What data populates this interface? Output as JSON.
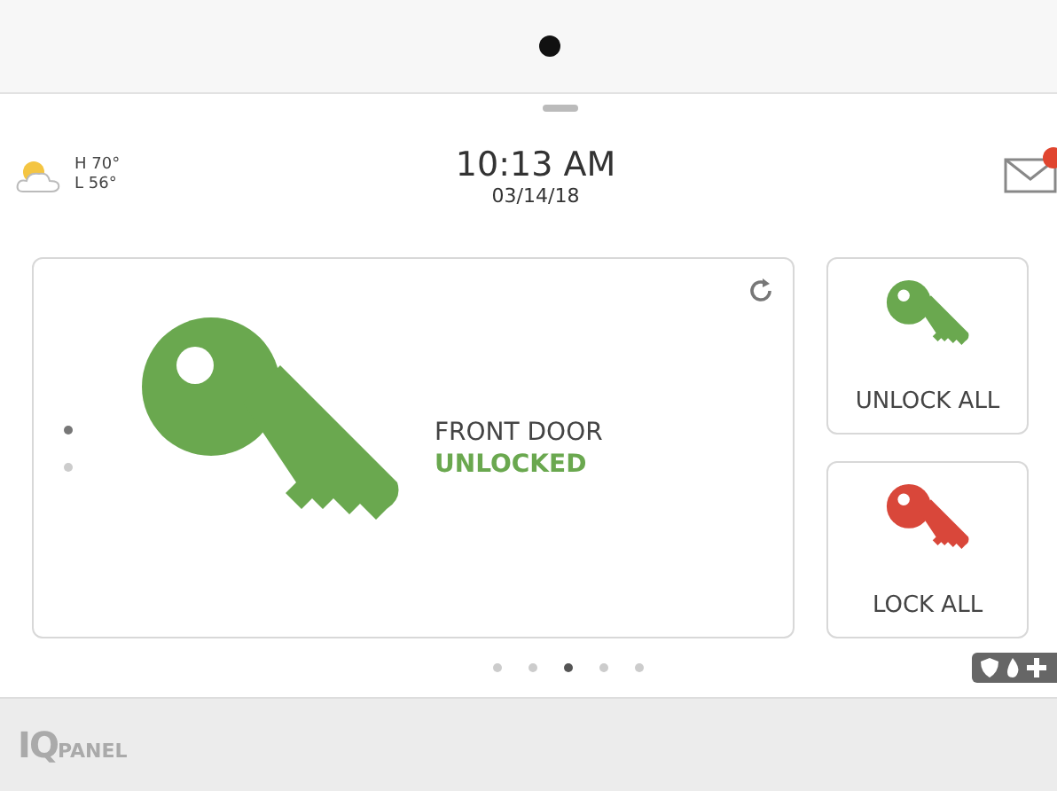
{
  "weather": {
    "high": "H 70°",
    "low": "L 56°"
  },
  "clock": {
    "time": "10:13 AM",
    "date": "03/14/18"
  },
  "mail": {
    "unread": true
  },
  "lock_card": {
    "name": "FRONT DOOR",
    "status": "UNLOCKED",
    "kind": "unlocked",
    "color": "#6aa84f"
  },
  "side_dots": [
    {
      "selected": true
    },
    {
      "selected": false
    }
  ],
  "buttons": [
    {
      "label": "UNLOCK ALL",
      "color": "#6aa84f"
    },
    {
      "label": "LOCK ALL",
      "color": "#d9473a"
    }
  ],
  "pager": [
    {
      "selected": false
    },
    {
      "selected": false
    },
    {
      "selected": true
    },
    {
      "selected": false
    },
    {
      "selected": false
    }
  ],
  "brand": {
    "mark": "IQ",
    "word": "PANEL"
  }
}
